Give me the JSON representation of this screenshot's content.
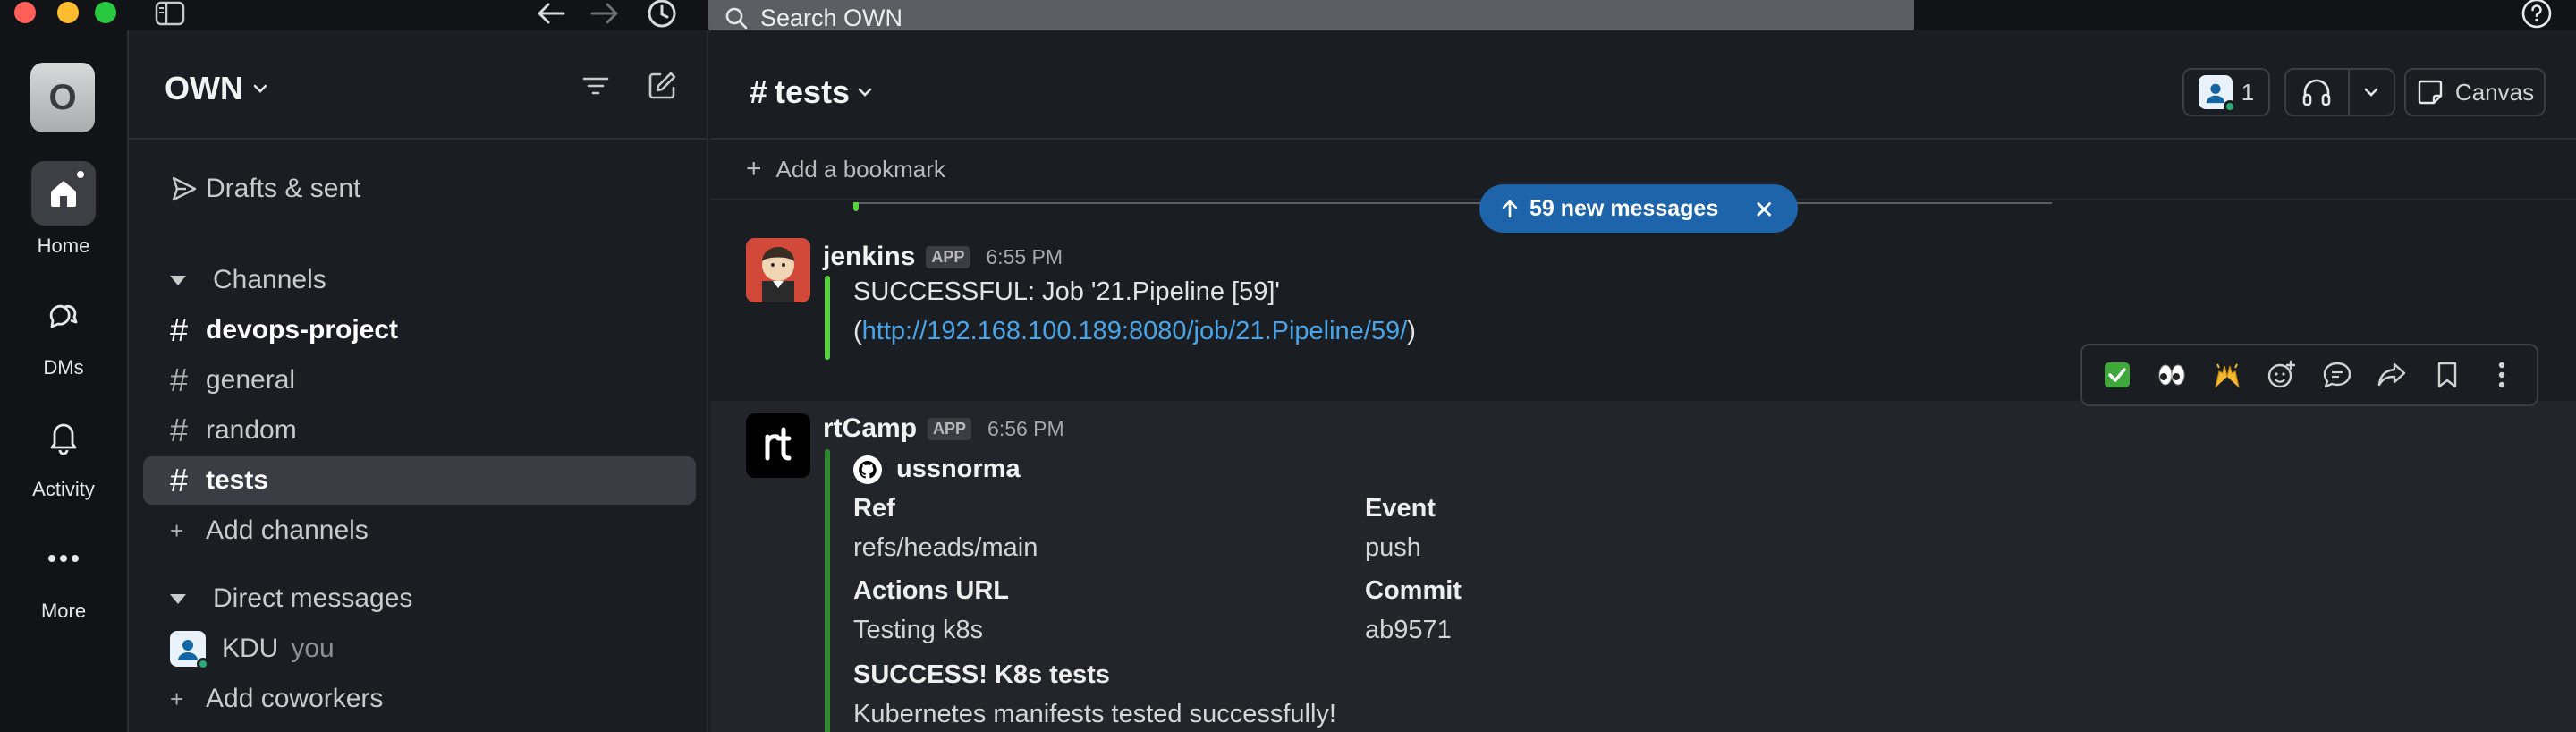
{
  "search": {
    "placeholder": "Search OWN"
  },
  "rail": {
    "workspace_initial": "O",
    "items": [
      {
        "label": "Home"
      },
      {
        "label": "DMs"
      },
      {
        "label": "Activity"
      },
      {
        "label": "More"
      }
    ]
  },
  "sidebar": {
    "workspace_name": "OWN",
    "drafts_label": "Drafts & sent",
    "channels_header": "Channels",
    "channels": [
      {
        "name": "devops-project"
      },
      {
        "name": "general"
      },
      {
        "name": "random"
      },
      {
        "name": "tests"
      }
    ],
    "add_channels": "Add channels",
    "dm_header": "Direct messages",
    "dm_user": "KDU",
    "dm_you": "you",
    "add_coworkers": "Add coworkers"
  },
  "channel": {
    "name": "tests",
    "members_count": "1",
    "canvas_label": "Canvas",
    "add_bookmark": "Add a bookmark",
    "new_messages": "59 new messages"
  },
  "messages": [
    {
      "author": "jenkins",
      "badge": "APP",
      "time": "6:55 PM",
      "line1": "SUCCESSFUL: Job '21.Pipeline [59]'",
      "line2_open": "(",
      "link": "http://192.168.100.189:8080/job/21.Pipeline/59/",
      "line2_close": ")"
    },
    {
      "author": "rtCamp",
      "badge": "APP",
      "time": "6:56 PM",
      "repo": "ussnorma",
      "fields": [
        {
          "label": "Ref",
          "value": "refs/heads/main"
        },
        {
          "label": "Event",
          "value": "push"
        },
        {
          "label": "Actions URL",
          "value": "Testing k8s"
        },
        {
          "label": "Commit",
          "value": "ab9571"
        }
      ],
      "result_title": "SUCCESS! K8s tests",
      "result_text": "Kubernetes manifests tested successfully!"
    }
  ],
  "colors": {
    "accent_blue": "#1d64ab",
    "link": "#4aa4e8",
    "jenkins_bar": "#58d13e",
    "rtcamp_bar": "#2c8a2c"
  }
}
